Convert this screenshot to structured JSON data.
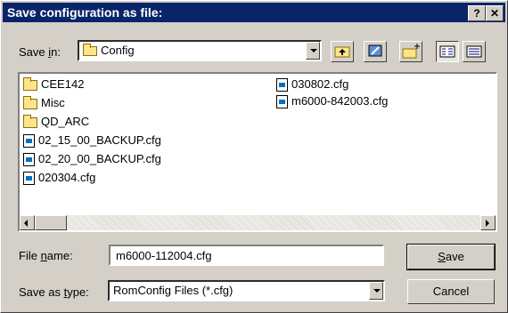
{
  "dialog": {
    "title": "Save configuration as file:",
    "help_label": "?",
    "close_label": "✕"
  },
  "save_in": {
    "label_prefix": "Save ",
    "label_underline": "i",
    "label_suffix": "n:",
    "value": "Config"
  },
  "toolbar": {
    "icons": [
      "up-folder-icon",
      "desktop-icon",
      "new-folder-icon",
      "list-view-icon",
      "details-view-icon"
    ]
  },
  "files": {
    "column1": [
      {
        "name": "CEE142",
        "type": "folder"
      },
      {
        "name": "Misc",
        "type": "folder"
      },
      {
        "name": "QD_ARC",
        "type": "folder"
      },
      {
        "name": "02_15_00_BACKUP.cfg",
        "type": "file"
      },
      {
        "name": "02_20_00_BACKUP.cfg",
        "type": "file"
      },
      {
        "name": "020304.cfg",
        "type": "file"
      }
    ],
    "column2": [
      {
        "name": "030802.cfg",
        "type": "file"
      },
      {
        "name": "m6000-842003.cfg",
        "type": "file"
      }
    ]
  },
  "filename": {
    "label_prefix": "File ",
    "label_underline": "n",
    "label_suffix": "ame:",
    "value": "m6000-112004.cfg"
  },
  "filetype": {
    "label_prefix": "Save as ",
    "label_underline": "t",
    "label_suffix": "ype:",
    "value": "RomConfig Files (*.cfg)"
  },
  "buttons": {
    "save_underline": "S",
    "save_rest": "ave",
    "cancel": "Cancel"
  }
}
